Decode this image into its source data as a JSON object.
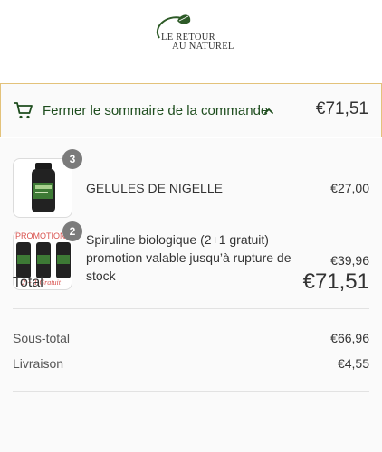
{
  "header": {
    "logo_line1": "LE RETOUR",
    "logo_line2": "AU NATUREL"
  },
  "summary_toggle": {
    "label": "Fermer le sommaire de la commande",
    "icon": "cart-icon",
    "chevron_icon": "chevron-up-icon",
    "total": "€71,51"
  },
  "items": [
    {
      "name": "GELULES DE NIGELLE",
      "quantity": "3",
      "price": "€27,00"
    },
    {
      "name_lines": [
        "Spiruline biologique (2+1 gratuit)",
        "promotion valable jusqu’à rupture de",
        "stock"
      ],
      "quantity": "2",
      "price": "€39,96",
      "image_text_top": "PROMOTION",
      "image_text_bottom": "2 + 1 Gratuit"
    }
  ],
  "totals": {
    "subtotal_label": "Sous-total",
    "subtotal_value": "€66,96",
    "shipping_label": "Livraison",
    "shipping_value": "€4,55",
    "total_label": "Total",
    "total_value": "€71,51"
  },
  "colors": {
    "accent_green": "#1e4d1e",
    "border_gold": "#e3c27a"
  }
}
